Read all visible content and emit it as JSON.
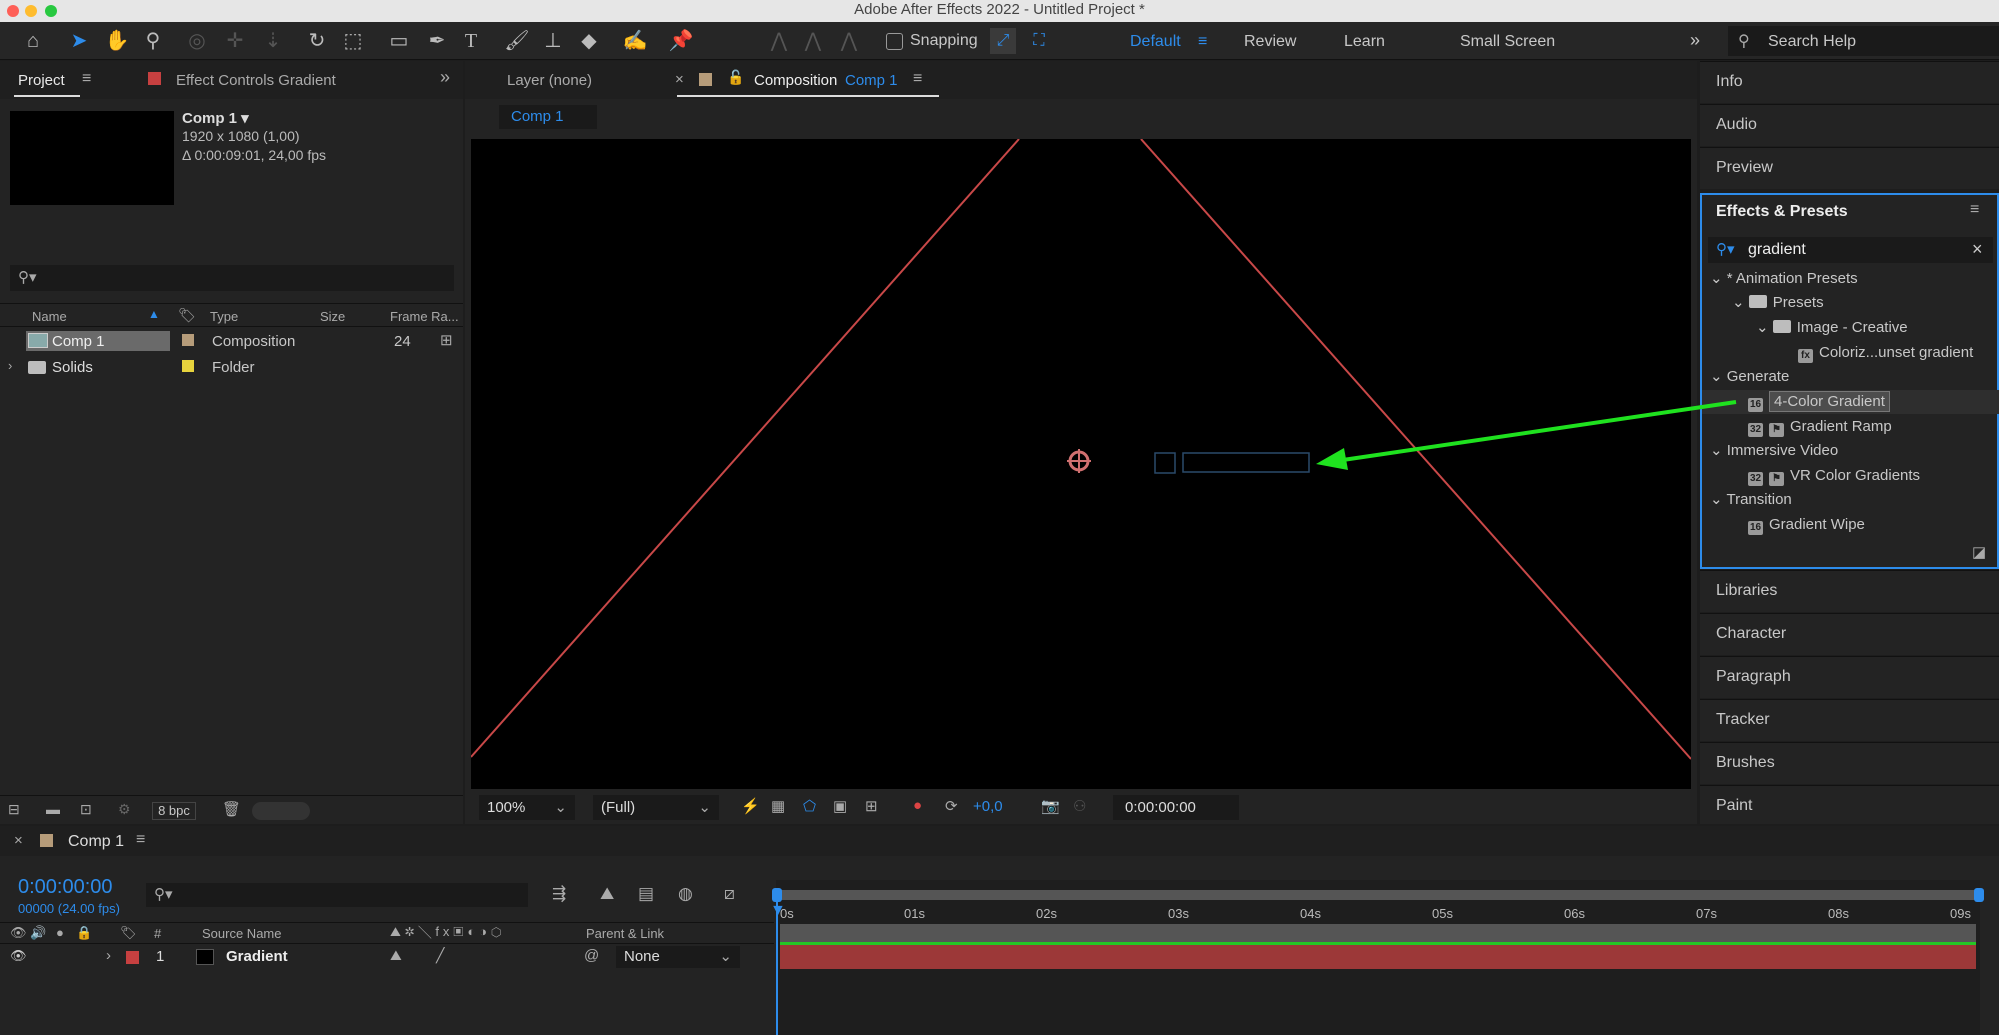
{
  "app": {
    "title": "Adobe After Effects 2022 - Untitled Project *"
  },
  "toolbar": {
    "snapping_label": "Snapping",
    "workspaces": [
      "Default",
      "Review",
      "Learn",
      "Small Screen"
    ],
    "search_help_placeholder": "Search Help",
    "icons": [
      "home-icon",
      "selection-tool-icon",
      "hand-tool-icon",
      "zoom-tool-icon",
      "orbit-icon",
      "pan-icon",
      "dolly-icon",
      "rotate-icon",
      "camera-icon",
      "rectangle-icon",
      "pen-icon",
      "type-icon",
      "brush-icon",
      "clone-stamp-icon",
      "eraser-icon",
      "roto-brush-icon",
      "puppet-pin-icon"
    ]
  },
  "project_panel": {
    "tab_project": "Project",
    "tab_effect_controls": "Effect Controls Gradient",
    "comp_name": "Comp 1 ▾",
    "comp_resolution": "1920 x 1080 (1,00)",
    "comp_duration": "Δ 0:00:09:01, 24,00 fps",
    "columns": [
      "Name",
      "Type",
      "Size",
      "Frame Ra..."
    ],
    "items": [
      {
        "name": "Comp 1",
        "type": "Composition",
        "frame_rate": "24",
        "label_color": "#b69c7a"
      },
      {
        "name": "Solids",
        "type": "Folder",
        "frame_rate": "",
        "label_color": "#e7d33d"
      }
    ],
    "bpc": "8 bpc"
  },
  "viewer": {
    "tab_layer": "Layer (none)",
    "tab_composition": "Composition",
    "tab_comp_name": "Comp 1",
    "breadcrumb": "Comp 1",
    "zoom": "100%",
    "resolution": "(Full)",
    "exposure": "+0,0",
    "timecode": "0:00:00:00"
  },
  "right_panels": {
    "top_tabs": [
      "Info",
      "Audio",
      "Preview"
    ],
    "effects_title": "Effects & Presets",
    "search_value": "gradient",
    "tree": [
      {
        "label": "* Animation Presets",
        "kind": "category"
      },
      {
        "label": "Presets",
        "kind": "folder"
      },
      {
        "label": "Image - Creative",
        "kind": "folder"
      },
      {
        "label": "Coloriz...unset gradient",
        "kind": "preset"
      },
      {
        "label": "Generate",
        "kind": "category"
      },
      {
        "label": "4-Color Gradient",
        "kind": "effect",
        "badge": "16"
      },
      {
        "label": "Gradient Ramp",
        "kind": "effect",
        "badge": "32"
      },
      {
        "label": "Immersive Video",
        "kind": "category"
      },
      {
        "label": "VR Color Gradients",
        "kind": "effect",
        "badge": "32"
      },
      {
        "label": "Transition",
        "kind": "category"
      },
      {
        "label": "Gradient Wipe",
        "kind": "effect",
        "badge": "16"
      }
    ],
    "bottom_tabs": [
      "Libraries",
      "Character",
      "Paragraph",
      "Tracker",
      "Brushes",
      "Paint"
    ]
  },
  "timeline": {
    "tab_name": "Comp 1",
    "current_time": "0:00:00:00",
    "frame_info": "00000 (24.00 fps)",
    "ruler": [
      "0s",
      "01s",
      "02s",
      "03s",
      "04s",
      "05s",
      "06s",
      "07s",
      "08s",
      "09s"
    ],
    "columns": {
      "num": "#",
      "source": "Source Name",
      "parent": "Parent & Link"
    },
    "layers": [
      {
        "num": "1",
        "name": "Gradient",
        "parent": "None",
        "label_color": "#c64040"
      }
    ]
  }
}
